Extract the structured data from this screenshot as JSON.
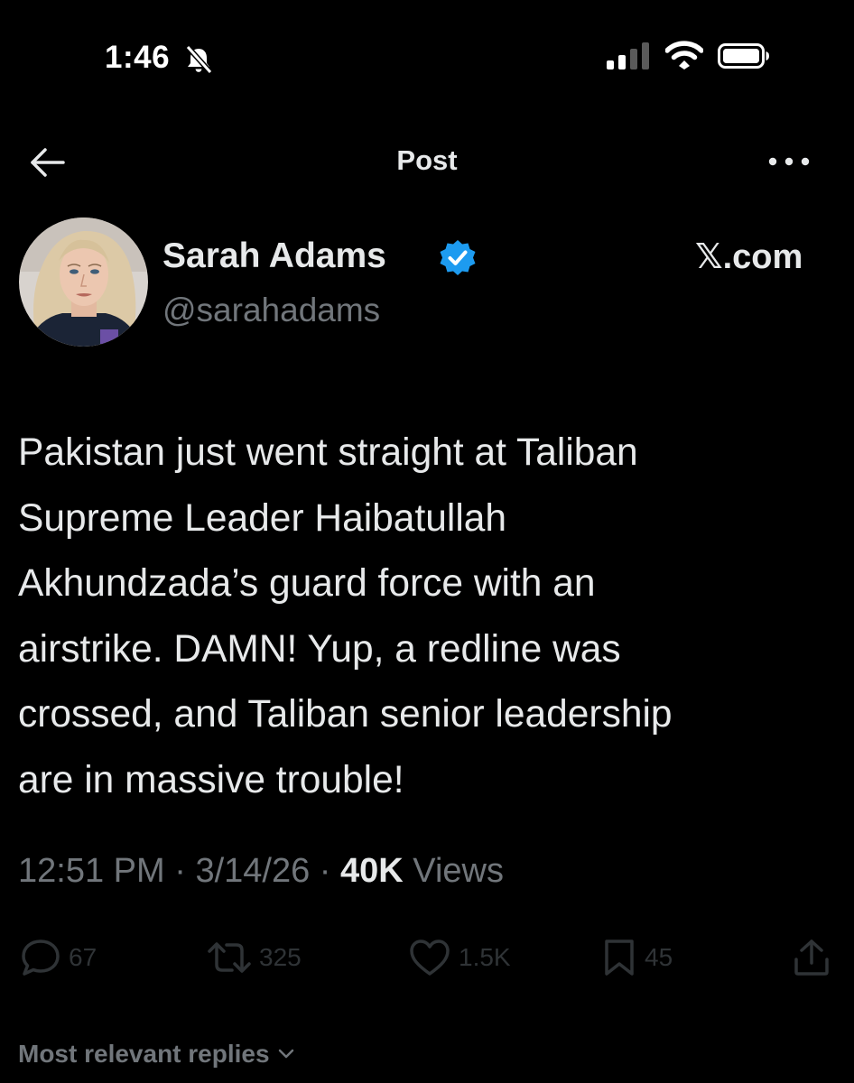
{
  "status_bar": {
    "time": "1:46",
    "icons": [
      "bell-slash-icon",
      "cellular-signal-icon",
      "wifi-icon",
      "battery-icon"
    ]
  },
  "header": {
    "title": "Post",
    "back_icon": "arrow-left-icon",
    "more_icon": "more-horizontal-icon"
  },
  "author": {
    "name": "Sarah Adams",
    "handle": "@sarahadams",
    "verified": true,
    "badge_color": "#1d9bf0"
  },
  "watermark": "𝕏.com",
  "tweet": {
    "lines": [
      "Pakistan just went straight at Taliban",
      "Supreme Leader Haibatullah",
      "Akhundzada’s guard force with an",
      "airstrike. DAMN! Yup, a redline was",
      "crossed, and Taliban senior leadership",
      "are in massive trouble!"
    ],
    "time": "12:51 PM",
    "date": "3/14/26",
    "views_count": "40K",
    "views_label": "Views"
  },
  "actions": {
    "replies": "67",
    "reposts": "325",
    "likes": "1.5K",
    "bookmarks": "45"
  },
  "replies_sort": {
    "label": "Most relevant replies"
  },
  "colors": {
    "background": "#000000",
    "primary_text": "#e7e9ea",
    "secondary_text": "#71767b",
    "verified_blue": "#1d9bf0"
  }
}
